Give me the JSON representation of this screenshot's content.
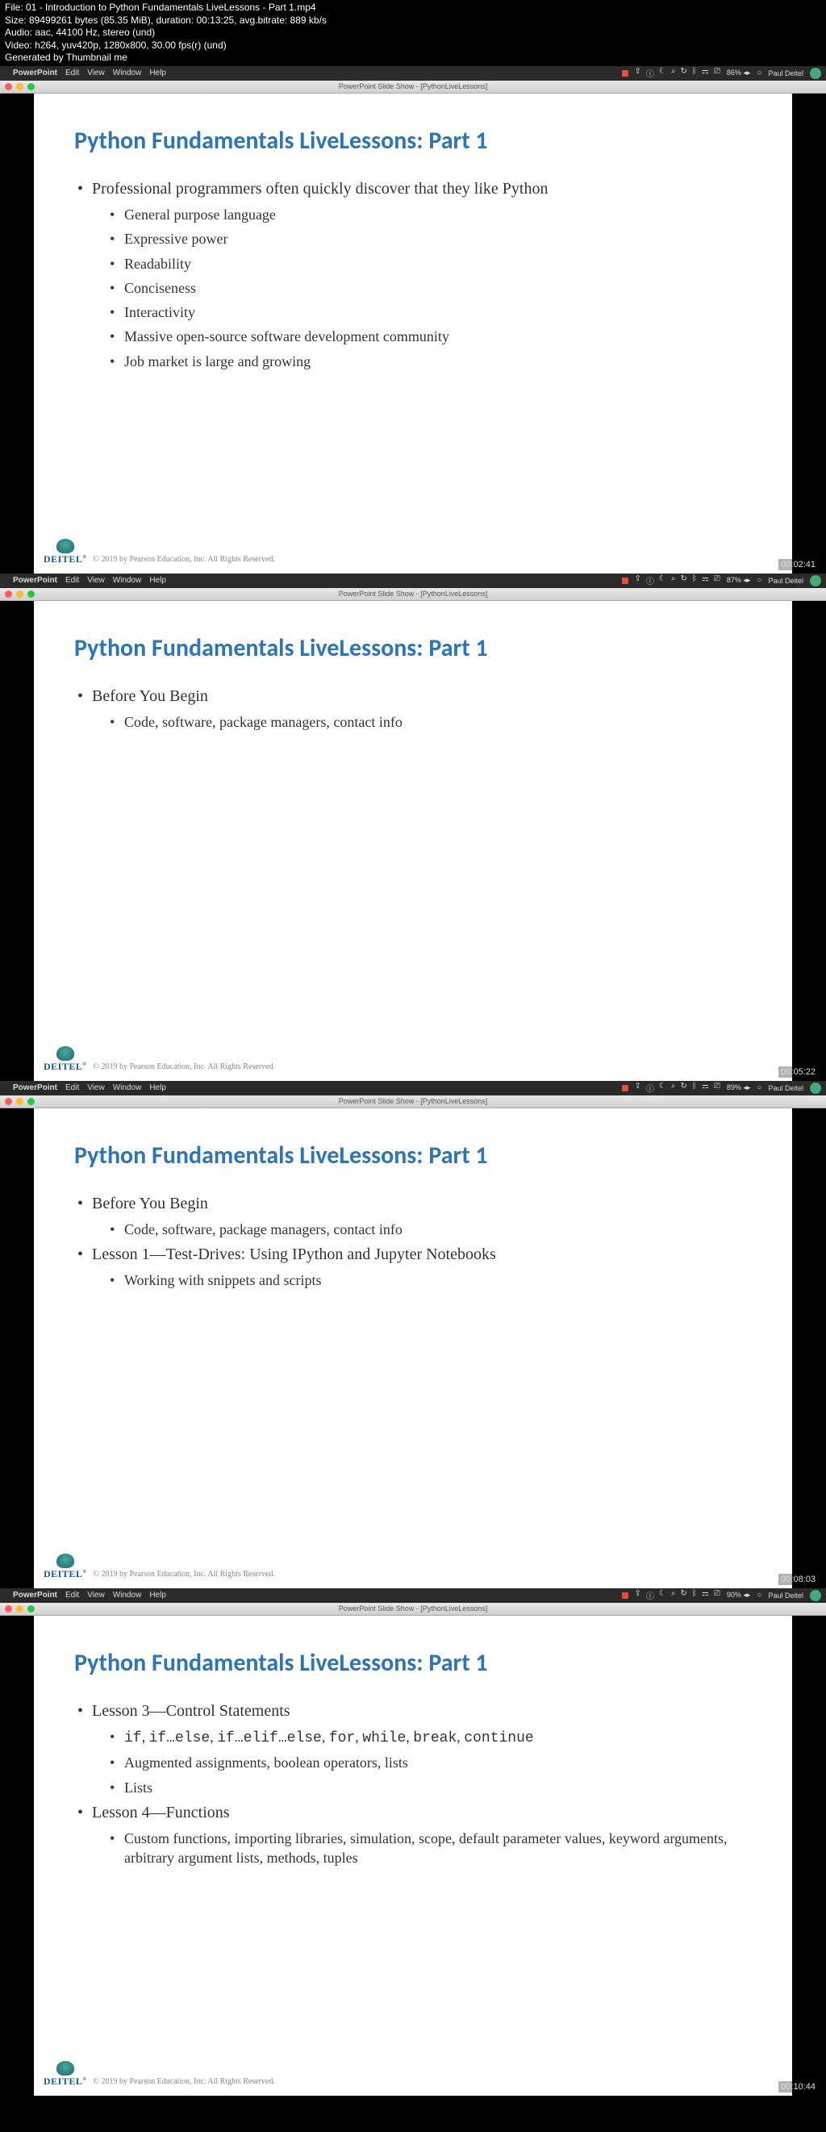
{
  "fileInfo": {
    "file": "File: 01 - Introduction to Python Fundamentals LiveLessons - Part 1.mp4",
    "size": "Size: 89499261 bytes (85.35 MiB), duration: 00:13:25, avg.bitrate: 889 kb/s",
    "audio": "Audio: aac, 44100 Hz, stereo (und)",
    "video": "Video: h264, yuv420p, 1280x800, 30.00 fps(r) (und)",
    "generated": "Generated by Thumbnail me"
  },
  "menubar": {
    "apple": "",
    "appName": "PowerPoint",
    "menus": [
      "Edit",
      "View",
      "Window",
      "Help"
    ],
    "user": "Paul Deitel"
  },
  "titlebar": {
    "title": "PowerPoint Slide Show - [PythonLiveLessons]"
  },
  "slideTitle": "Python Fundamentals LiveLessons: Part 1",
  "copyright": "© 2019 by Pearson Education, Inc. All Rights Reserved.",
  "deitel": "DEITEL",
  "frames": [
    {
      "battery": "86%",
      "timestamp": "00:02:41",
      "content": [
        {
          "text": "Professional programmers often quickly discover that they like Python",
          "sub": [
            "General purpose language",
            "Expressive power",
            "Readability",
            "Conciseness",
            "Interactivity",
            "Massive open-source software development community",
            "Job market is large and growing"
          ]
        }
      ]
    },
    {
      "battery": "87%",
      "timestamp": "00:05:22",
      "content": [
        {
          "text": "Before You Begin",
          "sub": [
            "Code, software, package managers, contact info"
          ]
        }
      ]
    },
    {
      "battery": "89%",
      "timestamp": "00:08:03",
      "content": [
        {
          "text": "Before You Begin",
          "sub": [
            "Code, software, package managers, contact info"
          ]
        },
        {
          "text": "Lesson 1—Test-Drives: Using IPython and Jupyter Notebooks",
          "sub": [
            "Working with snippets and scripts"
          ]
        }
      ]
    },
    {
      "battery": "90%",
      "timestamp": "00:10:44",
      "content": [
        {
          "text": "Lesson 3—Control Statements",
          "sub": [
            {
              "html": "<span class='mono'>if</span>, <span class='mono'>if…else</span>, <span class='mono'>if…elif…else</span>, <span class='mono'>for</span>, <span class='mono'>while</span>, <span class='mono'>break</span>, <span class='mono'>continue</span>"
            },
            "Augmented assignments, boolean operators, lists",
            "Lists"
          ]
        },
        {
          "text": "Lesson 4—Functions",
          "sub": [
            "Custom functions, importing libraries, simulation, scope, default parameter values, keyword arguments, arbitrary argument lists, methods, tuples"
          ]
        }
      ]
    }
  ]
}
